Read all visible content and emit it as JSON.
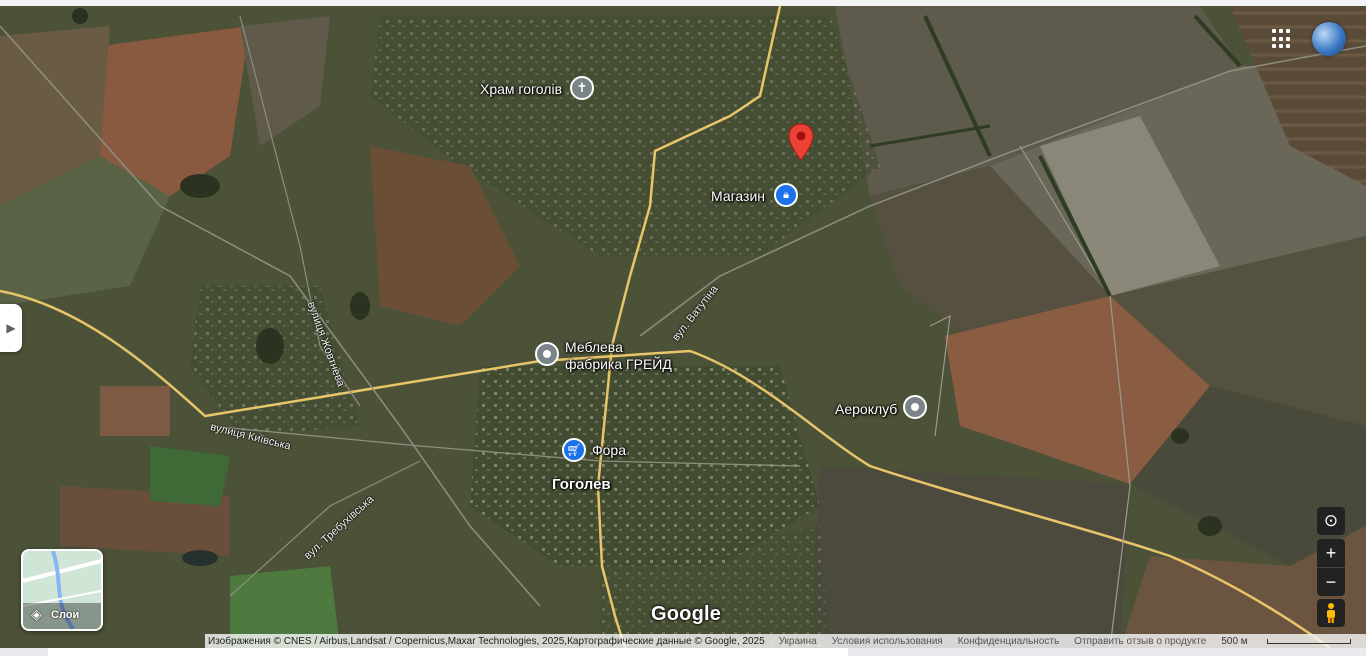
{
  "map": {
    "places": [
      {
        "name": "Храм гоголів",
        "type": "church"
      },
      {
        "name": "Магазин",
        "type": "shop"
      },
      {
        "name": "Меблева",
        "name2": "фабрика ГРЕЙД",
        "type": "poi"
      },
      {
        "name": "Аероклуб",
        "type": "poi"
      },
      {
        "name": "Фора",
        "type": "shop"
      },
      {
        "name": "Гоголев",
        "type": "town"
      }
    ],
    "streets": [
      {
        "name": "вулиця Жовтнева"
      },
      {
        "name": "вул. Ватутіна"
      },
      {
        "name": "вулиця Київська"
      },
      {
        "name": "вул. Требухівська"
      }
    ]
  },
  "ui": {
    "layers_label": "Слои",
    "google_logo": "Google",
    "icons": {
      "collapse": "chevron-right-icon",
      "layers": "layers-icon",
      "apps": "apps-grid-icon",
      "account": "globe-avatar-icon",
      "location": "my-location-icon",
      "zoom_in": "plus-icon",
      "zoom_out": "minus-icon",
      "pegman": "pegman-icon"
    },
    "zoom_in_label": "+",
    "zoom_out_label": "−"
  },
  "attribution": {
    "credit": "Изображения © CNES / Airbus,Landsat / Copernicus,Maxar Technologies, 2025,Картографические данные © Google, 2025",
    "country": "Украина",
    "terms": "Условия использования",
    "privacy": "Конфиденциальность",
    "feedback": "Отправить отзыв о продукте",
    "scale": "500 м"
  },
  "colors": {
    "road_yellow": "#e8c46a",
    "pin_red": "#ea4335",
    "pin_blue": "#1a73e8",
    "pin_grey": "#7b8589"
  }
}
